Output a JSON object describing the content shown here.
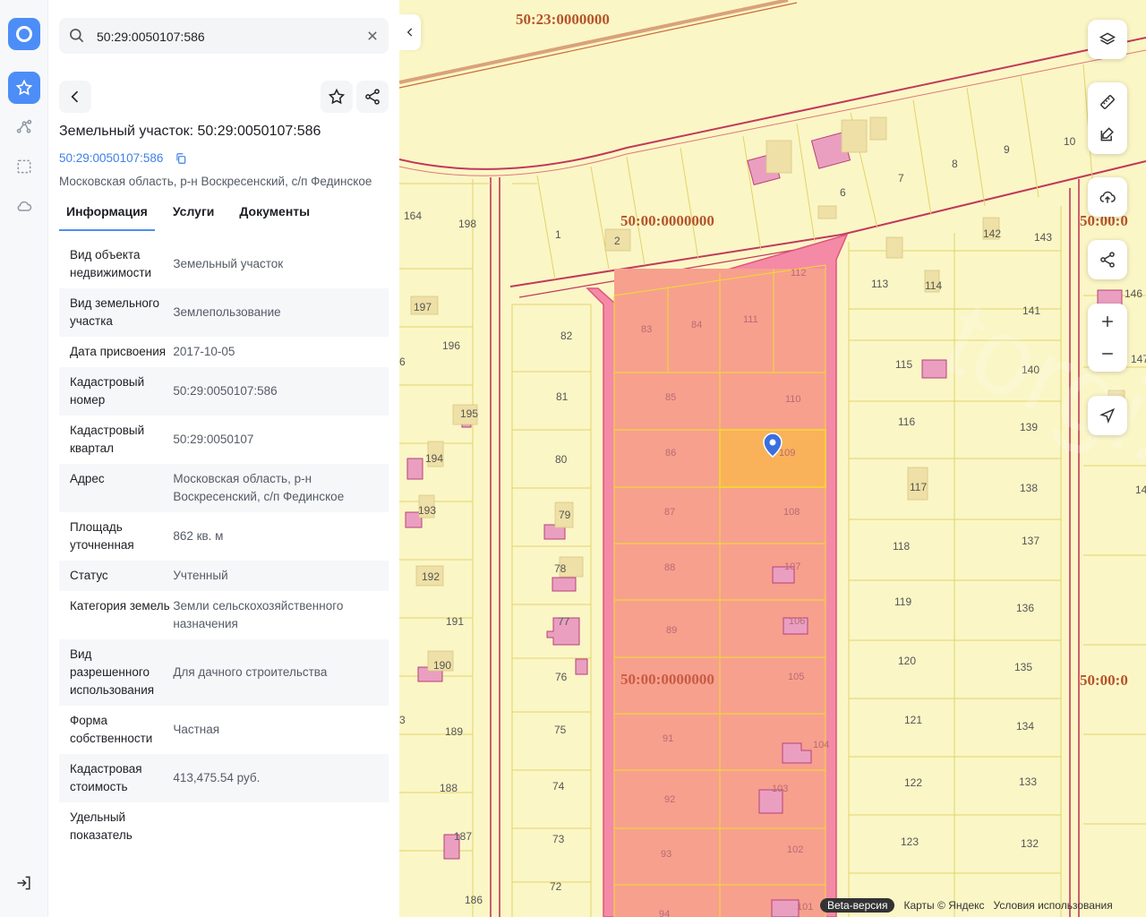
{
  "search": {
    "value": "50:29:0050107:586"
  },
  "card": {
    "title": "Земельный участок: 50:29:0050107:586",
    "cad_link": "50:29:0050107:586",
    "address": "Московская область, р-н Воскресенский, с/п Фединское"
  },
  "tabs": [
    "Информация",
    "Услуги",
    "Документы"
  ],
  "info": [
    {
      "k": "Вид объекта недвижимости",
      "v": "Земельный участок"
    },
    {
      "k": "Вид земельного участка",
      "v": "Землепользование"
    },
    {
      "k": "Дата присвоения",
      "v": "2017-10-05"
    },
    {
      "k": "Кадастровый номер",
      "v": "50:29:0050107:586"
    },
    {
      "k": "Кадастровый квартал",
      "v": "50:29:0050107"
    },
    {
      "k": "Адрес",
      "v": "Московская область, р-н Воскресенский, с/п Фединское"
    },
    {
      "k": "Площадь уточненная",
      "v": "862 кв. м"
    },
    {
      "k": "Статус",
      "v": "Учтенный"
    },
    {
      "k": "Категория земель",
      "v": "Земли сельскохозяйственного назначения"
    },
    {
      "k": "Вид разрешенного использования",
      "v": "Для дачного строительства"
    },
    {
      "k": "Форма собственности",
      "v": "Частная"
    },
    {
      "k": "Кадастровая стоимость",
      "v": "413,475.54 руб."
    },
    {
      "k": "Удельный показатель",
      "v": ""
    }
  ],
  "map": {
    "quarters": [
      "50:23:0000000",
      "50:00:0000000",
      "50:00:0000000",
      "50:00:0",
      "50:00:0"
    ],
    "plots_top": [
      "1",
      "2",
      "6",
      "7",
      "8",
      "9",
      "10",
      "164",
      "198"
    ],
    "plots_right_a": [
      "113",
      "114",
      "115",
      "116",
      "117",
      "118",
      "119",
      "120",
      "121",
      "122",
      "123"
    ],
    "plots_right_b": [
      "142",
      "143",
      "141",
      "140",
      "139",
      "138",
      "137",
      "136",
      "135",
      "134",
      "133",
      "132"
    ],
    "plots_right_c": [
      "146",
      "147",
      "14"
    ],
    "plots_center_left": [
      "83",
      "84",
      "85",
      "86",
      "87",
      "88",
      "89",
      "91",
      "92",
      "93",
      "94"
    ],
    "plots_center_right": [
      "112",
      "111",
      "110",
      "109",
      "108",
      "107",
      "106",
      "105",
      "104",
      "103",
      "102",
      "101"
    ],
    "plots_mid": [
      "82",
      "81",
      "80",
      "79",
      "78",
      "77",
      "76",
      "75",
      "74",
      "73",
      "72"
    ],
    "plots_left": [
      "197",
      "196",
      "195",
      "194",
      "193",
      "192",
      "191",
      "190",
      "189",
      "188",
      "187",
      "186",
      "6",
      "3"
    ],
    "colors": {
      "base": "#fbf6c6",
      "highlight": "#f48aa6",
      "selected": "#f9b25a",
      "boundary": "#c1395c",
      "label": "#b5542a"
    }
  },
  "footer": {
    "beta": "Beta-версия",
    "maps": "Карты © Яндекс",
    "terms": "Условия использования"
  }
}
